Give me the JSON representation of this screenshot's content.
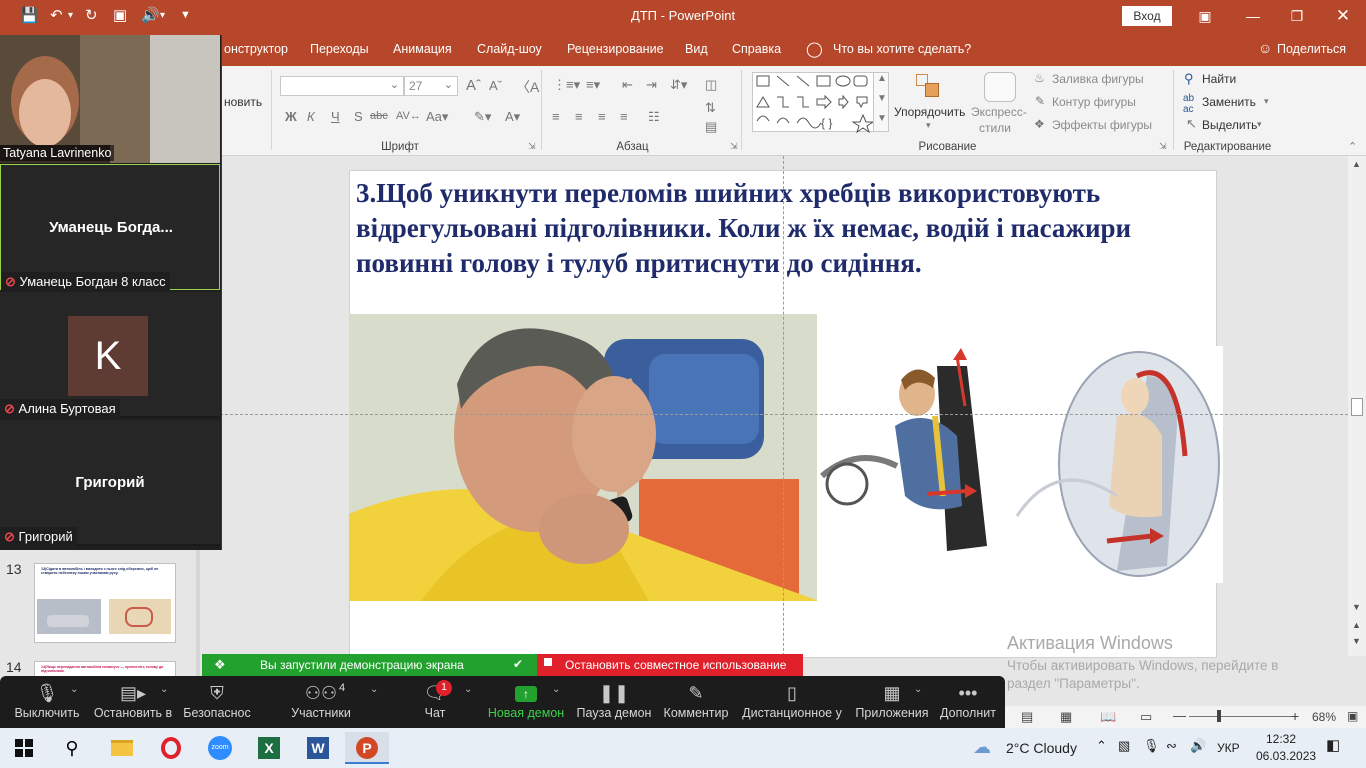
{
  "titlebar": {
    "doc_title": "ДТП - PowerPoint",
    "signin": "Вход",
    "icons": [
      "save-icon",
      "undo-icon",
      "redo-icon",
      "present-icon",
      "speaker-icon",
      "customize-icon"
    ]
  },
  "tabs": [
    "онструктор",
    "Переходы",
    "Анимация",
    "Слайд-шоу",
    "Рецензирование",
    "Вид",
    "Справка"
  ],
  "tell_me": "Что вы хотите сделать?",
  "share": "Поделиться",
  "ribbon": {
    "clipboard_fragment": "новить",
    "font_size": "27",
    "font_group": "Шрифт",
    "paragraph_group": "Абзац",
    "drawing_group": "Рисование",
    "editing_group": "Редактирование",
    "arrange": "Упорядочить",
    "quick_styles_1": "Экспресс-",
    "quick_styles_2": "стили",
    "shape_fill": "Заливка фигуры",
    "shape_outline": "Контур фигуры",
    "shape_effects": "Эффекты фигуры",
    "find": "Найти",
    "replace": "Заменить",
    "select": "Выделить"
  },
  "slide": {
    "text": "3.Щоб уникнути переломів шийних хребців використовують відрегульовані підголівники. Коли ж їх немає, водій і пасажири повинні голову і тулуб притиснути до сидіння."
  },
  "thumbnails": [
    {
      "number": "13",
      "text": "13)Сідати в автомобіль і виходити з нього слід обережно, щоб не створити небезпеку іншим учасникам руху."
    },
    {
      "number": "14",
      "text": "14)Якщо перекидання автомобіля неминуче — притисніть голову до підголівника."
    }
  ],
  "zoom": {
    "self_name": "Tatyana Lavrinenko",
    "participants": [
      {
        "display": "Уманець  Богда...",
        "label": "Уманець Богдан 8 класс"
      },
      {
        "avatar": "K",
        "label": "Алина Буртовая"
      },
      {
        "display": "Григорий",
        "label": "Григорий"
      }
    ],
    "sharing_msg": "Вы запустили демонстрацию экрана",
    "stop_share": "Остановить совместное использование",
    "toolbar": [
      {
        "label": "Выключить",
        "icon": "microphone-icon"
      },
      {
        "label": "Остановить в",
        "icon": "video-camera-icon"
      },
      {
        "label": "Безопаснос",
        "icon": "shield-icon"
      },
      {
        "label": "Участники",
        "icon": "participants-icon",
        "count": "4"
      },
      {
        "label": "Чат",
        "icon": "chat-icon",
        "badge": "1"
      },
      {
        "label": "Новая демон",
        "icon": "share-screen-icon"
      },
      {
        "label": "Пауза демон",
        "icon": "pause-icon"
      },
      {
        "label": "Комментир",
        "icon": "pencil-icon"
      },
      {
        "label": "Дистанционное у",
        "icon": "mouse-icon"
      },
      {
        "label": "Приложения",
        "icon": "apps-icon"
      },
      {
        "label": "Дополнит",
        "icon": "more-icon"
      }
    ]
  },
  "activation": {
    "title": "Активация Windows",
    "line1": "Чтобы активировать Windows, перейдите в",
    "line2": "раздел \"Параметры\"."
  },
  "statusbar": {
    "zoom": "68%"
  },
  "taskbar": {
    "weather": "2°C  Cloudy",
    "lang": "УКР",
    "time": "12:32",
    "date": "06.03.2023"
  },
  "colors": {
    "ppt_accent": "#b7472a",
    "slide_text": "#1f2b6b",
    "zoom_green": "#23a12f",
    "zoom_red": "#e0202b"
  }
}
